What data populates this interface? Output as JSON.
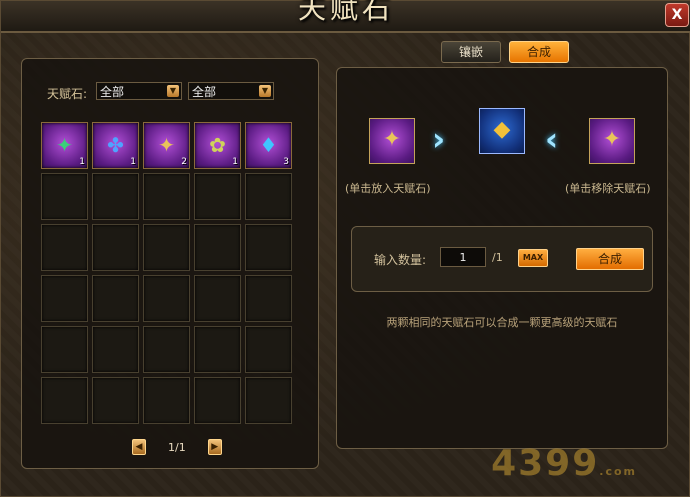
{
  "window": {
    "title": "天赋石",
    "close_label": "X"
  },
  "tabs": [
    {
      "label": "镶嵌",
      "active": false
    },
    {
      "label": "合成",
      "active": true
    }
  ],
  "filter": {
    "label": "天赋石:",
    "select1": "全部",
    "select2": "全部"
  },
  "inventory": {
    "items": [
      {
        "icon": "green-gem-icon",
        "glyph": "✦",
        "color": "#3ad17a",
        "count": "1"
      },
      {
        "icon": "blue-gem-icon",
        "glyph": "✤",
        "color": "#4fa3ff",
        "count": "1"
      },
      {
        "icon": "gold-gem-icon",
        "glyph": "✦",
        "color": "#e9c45a",
        "count": "2"
      },
      {
        "icon": "yellow-green-gem-icon",
        "glyph": "✿",
        "color": "#cfd35a",
        "count": "1"
      },
      {
        "icon": "cyan-gem-icon",
        "glyph": "♦",
        "color": "#3fc6ff",
        "count": "3"
      }
    ],
    "page": "1/1"
  },
  "synthesis": {
    "slot_left_icon": "gold-gem-icon",
    "slot_result_icon": "gold-gem-icon",
    "slot_right_icon": "gold-gem-icon",
    "hint_left": "(单击放入天赋石)",
    "hint_right": "(单击移除天赋石)",
    "qty_label": "输入数量:",
    "qty_value": "1",
    "qty_max": "/1",
    "max_button": "MAX",
    "synth_button": "合成",
    "description": "两颗相同的天赋石可以合成一颗更高级的天赋石"
  },
  "watermark": {
    "text": "4399",
    "suffix": ".com"
  },
  "colors": {
    "accent": "#f08a10",
    "gem_slot": "#7a2aa8",
    "result_slot": "#1f47a3"
  }
}
